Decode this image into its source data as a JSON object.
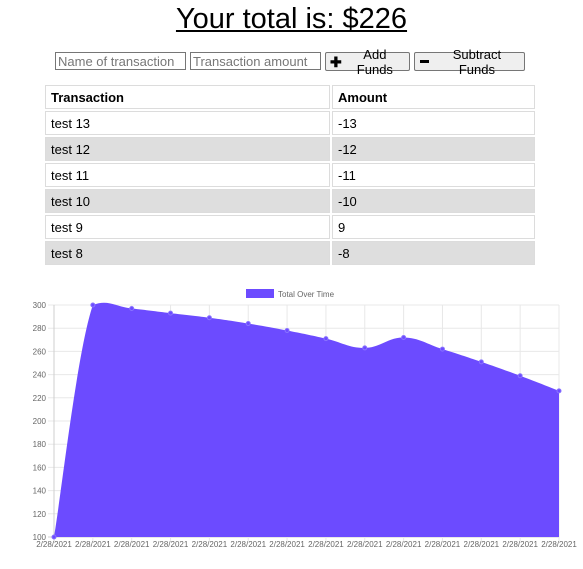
{
  "header": {
    "total_text": "Your total is: $226"
  },
  "form": {
    "name_placeholder": "Name of transaction",
    "amount_placeholder": "Transaction amount",
    "add_label": "Add Funds",
    "subtract_label": "Subtract Funds"
  },
  "table": {
    "headers": [
      "Transaction",
      "Amount"
    ],
    "rows": [
      {
        "name": "test 13",
        "amount": "-13"
      },
      {
        "name": "test 12",
        "amount": "-12"
      },
      {
        "name": "test 11",
        "amount": "-11"
      },
      {
        "name": "test 10",
        "amount": "-10"
      },
      {
        "name": "test 9",
        "amount": "9"
      },
      {
        "name": "test 8",
        "amount": "-8"
      }
    ]
  },
  "chart_data": {
    "type": "area",
    "legend": "Total Over Time",
    "legend_position": "top-center",
    "fill_color": "#6c4bff",
    "grid": true,
    "ylim": [
      100,
      300
    ],
    "y_ticks": [
      100,
      120,
      140,
      160,
      180,
      200,
      220,
      240,
      260,
      280,
      300
    ],
    "x": [
      "2/28/2021",
      "2/28/2021",
      "2/28/2021",
      "2/28/2021",
      "2/28/2021",
      "2/28/2021",
      "2/28/2021",
      "2/28/2021",
      "2/28/2021",
      "2/28/2021",
      "2/28/2021",
      "2/28/2021",
      "2/28/2021",
      "2/28/2021"
    ],
    "series": [
      {
        "name": "Total Over Time",
        "values": [
          100,
          300,
          297,
          293,
          289,
          284,
          278,
          271,
          263,
          272,
          262,
          251,
          239,
          226
        ]
      }
    ]
  }
}
